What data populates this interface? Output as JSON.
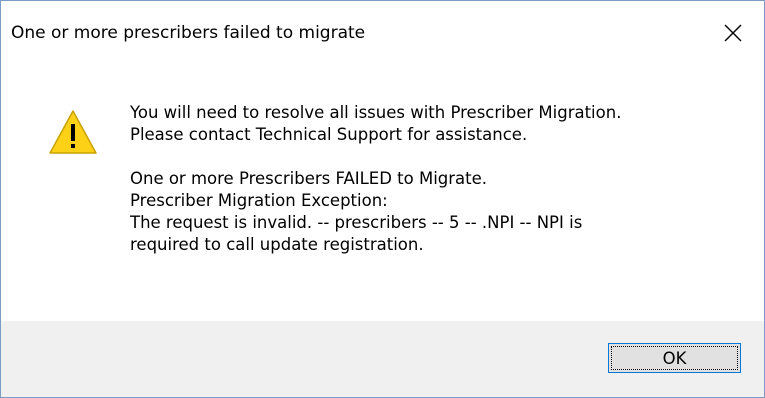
{
  "dialog": {
    "title": "One or more prescribers failed to migrate",
    "close_icon": "close-icon",
    "warning_icon": "warning-icon",
    "message_lines_1": [
      "You will need to resolve all issues with Prescriber Migration.",
      "Please contact Technical Support for assistance."
    ],
    "message_lines_2": [
      "One or more Prescribers FAILED to Migrate.",
      "Prescriber Migration Exception:",
      "The request is invalid. -- prescribers -- 5 -- .NPI -- NPI is",
      "required to call update registration."
    ],
    "ok_label": "OK"
  },
  "colors": {
    "border": "#7a9cc4",
    "footer_bg": "#f0f0f0",
    "button_bg": "#e1e1e1",
    "button_border": "#0078d7",
    "warning_fill": "#fcd116"
  }
}
